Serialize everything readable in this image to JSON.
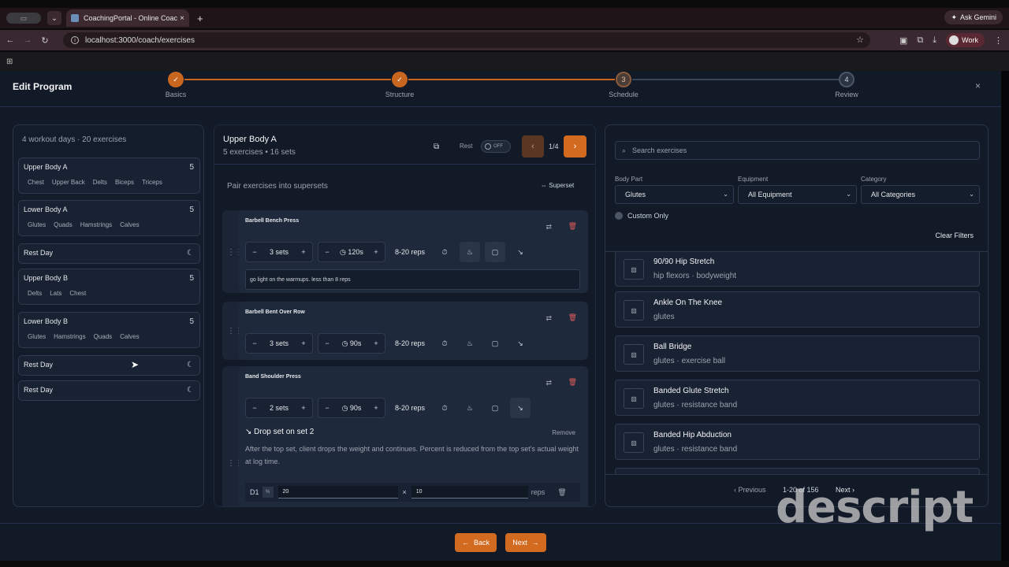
{
  "browser": {
    "tab_title": "CoachingPortal - Online Coac",
    "url": "localhost:3000/coach/exercises",
    "gemini_label": "Ask Gemini",
    "profile_label": "Work"
  },
  "header": {
    "title": "Edit Program",
    "steps": [
      {
        "num": "✓",
        "label": "Basics",
        "state": "done"
      },
      {
        "num": "✓",
        "label": "Structure",
        "state": "done"
      },
      {
        "num": "3",
        "label": "Schedule",
        "state": "current"
      },
      {
        "num": "4",
        "label": "Review",
        "state": "todo"
      }
    ],
    "close": "×"
  },
  "left": {
    "summary": "4 workout days · 20 exercises",
    "days": [
      {
        "name": "Upper Body A",
        "count": "5",
        "tags": [
          "Chest",
          "Upper Back",
          "Delts",
          "Biceps",
          "Triceps"
        ]
      },
      {
        "name": "Lower Body A",
        "count": "5",
        "tags": [
          "Glutes",
          "Quads",
          "Hamstrings",
          "Calves"
        ]
      },
      {
        "name": "Rest Day"
      },
      {
        "name": "Upper Body B",
        "count": "5",
        "tags": [
          "Delts",
          "Lats",
          "Chest"
        ]
      },
      {
        "name": "Lower Body B",
        "count": "5",
        "tags": [
          "Glutes",
          "Hamstrings",
          "Quads",
          "Calves"
        ]
      },
      {
        "name": "Rest Day"
      },
      {
        "name": "Rest Day"
      }
    ]
  },
  "middle": {
    "title": "Upper Body A",
    "subtitle": "5 exercises • 16 sets",
    "rest_label": "Rest",
    "rest_toggle": "OFF",
    "pager": "1/4",
    "pair_label": "Pair exercises into supersets",
    "superset_label": "Superset",
    "exercises": [
      {
        "name": "Barbell Bench Press",
        "sets": "3 sets",
        "rest": "120s",
        "reps": "8-20 reps",
        "note": "go light on the warmups. less than 8 reps"
      },
      {
        "name": "Barbell Bent Over Row",
        "sets": "3 sets",
        "rest": "90s",
        "reps": "8-20 reps"
      },
      {
        "name": "Band Shoulder Press",
        "sets": "2 sets",
        "rest": "90s",
        "reps": "8-20 reps"
      }
    ],
    "drop": {
      "title": "Drop set on set 2",
      "remove": "Remove",
      "desc": "After the top set, client drops the weight and continues. Percent is reduced from the top set's actual weight at log time.",
      "row_index": "D1",
      "pct_sym": "%",
      "pct_value": "20",
      "times": "×",
      "reps_value": "10",
      "reps_label": "reps"
    }
  },
  "right": {
    "search_placeholder": "Search exercises",
    "filters": [
      {
        "label": "Body Part",
        "value": "Glutes"
      },
      {
        "label": "Equipment",
        "value": "All Equipment"
      },
      {
        "label": "Category",
        "value": "All Categories"
      }
    ],
    "custom_only": "Custom Only",
    "clear_filters": "Clear Filters",
    "results": [
      {
        "name": "90/90 Hip Stretch",
        "desc": "hip flexors · bodyweight"
      },
      {
        "name": "Ankle On The Knee",
        "desc": "glutes"
      },
      {
        "name": "Ball Bridge",
        "desc": "glutes · exercise ball"
      },
      {
        "name": "Banded Glute Stretch",
        "desc": "glutes · resistance band"
      },
      {
        "name": "Banded Hip Abduction",
        "desc": "glutes · resistance band"
      }
    ],
    "prev": "Previous",
    "range": "1-20 of 156",
    "next": "Next"
  },
  "footer": {
    "back": "Back",
    "next": "Next"
  },
  "watermark": "descript"
}
